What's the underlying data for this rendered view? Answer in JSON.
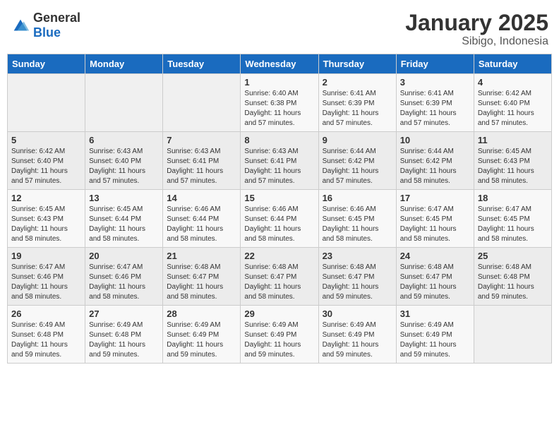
{
  "header": {
    "logo_general": "General",
    "logo_blue": "Blue",
    "month_title": "January 2025",
    "location": "Sibigo, Indonesia"
  },
  "weekdays": [
    "Sunday",
    "Monday",
    "Tuesday",
    "Wednesday",
    "Thursday",
    "Friday",
    "Saturday"
  ],
  "weeks": [
    [
      {
        "day": "",
        "sunrise": "",
        "sunset": "",
        "daylight": ""
      },
      {
        "day": "",
        "sunrise": "",
        "sunset": "",
        "daylight": ""
      },
      {
        "day": "",
        "sunrise": "",
        "sunset": "",
        "daylight": ""
      },
      {
        "day": "1",
        "sunrise": "Sunrise: 6:40 AM",
        "sunset": "Sunset: 6:38 PM",
        "daylight": "Daylight: 11 hours and 57 minutes."
      },
      {
        "day": "2",
        "sunrise": "Sunrise: 6:41 AM",
        "sunset": "Sunset: 6:39 PM",
        "daylight": "Daylight: 11 hours and 57 minutes."
      },
      {
        "day": "3",
        "sunrise": "Sunrise: 6:41 AM",
        "sunset": "Sunset: 6:39 PM",
        "daylight": "Daylight: 11 hours and 57 minutes."
      },
      {
        "day": "4",
        "sunrise": "Sunrise: 6:42 AM",
        "sunset": "Sunset: 6:40 PM",
        "daylight": "Daylight: 11 hours and 57 minutes."
      }
    ],
    [
      {
        "day": "5",
        "sunrise": "Sunrise: 6:42 AM",
        "sunset": "Sunset: 6:40 PM",
        "daylight": "Daylight: 11 hours and 57 minutes."
      },
      {
        "day": "6",
        "sunrise": "Sunrise: 6:43 AM",
        "sunset": "Sunset: 6:40 PM",
        "daylight": "Daylight: 11 hours and 57 minutes."
      },
      {
        "day": "7",
        "sunrise": "Sunrise: 6:43 AM",
        "sunset": "Sunset: 6:41 PM",
        "daylight": "Daylight: 11 hours and 57 minutes."
      },
      {
        "day": "8",
        "sunrise": "Sunrise: 6:43 AM",
        "sunset": "Sunset: 6:41 PM",
        "daylight": "Daylight: 11 hours and 57 minutes."
      },
      {
        "day": "9",
        "sunrise": "Sunrise: 6:44 AM",
        "sunset": "Sunset: 6:42 PM",
        "daylight": "Daylight: 11 hours and 57 minutes."
      },
      {
        "day": "10",
        "sunrise": "Sunrise: 6:44 AM",
        "sunset": "Sunset: 6:42 PM",
        "daylight": "Daylight: 11 hours and 58 minutes."
      },
      {
        "day": "11",
        "sunrise": "Sunrise: 6:45 AM",
        "sunset": "Sunset: 6:43 PM",
        "daylight": "Daylight: 11 hours and 58 minutes."
      }
    ],
    [
      {
        "day": "12",
        "sunrise": "Sunrise: 6:45 AM",
        "sunset": "Sunset: 6:43 PM",
        "daylight": "Daylight: 11 hours and 58 minutes."
      },
      {
        "day": "13",
        "sunrise": "Sunrise: 6:45 AM",
        "sunset": "Sunset: 6:44 PM",
        "daylight": "Daylight: 11 hours and 58 minutes."
      },
      {
        "day": "14",
        "sunrise": "Sunrise: 6:46 AM",
        "sunset": "Sunset: 6:44 PM",
        "daylight": "Daylight: 11 hours and 58 minutes."
      },
      {
        "day": "15",
        "sunrise": "Sunrise: 6:46 AM",
        "sunset": "Sunset: 6:44 PM",
        "daylight": "Daylight: 11 hours and 58 minutes."
      },
      {
        "day": "16",
        "sunrise": "Sunrise: 6:46 AM",
        "sunset": "Sunset: 6:45 PM",
        "daylight": "Daylight: 11 hours and 58 minutes."
      },
      {
        "day": "17",
        "sunrise": "Sunrise: 6:47 AM",
        "sunset": "Sunset: 6:45 PM",
        "daylight": "Daylight: 11 hours and 58 minutes."
      },
      {
        "day": "18",
        "sunrise": "Sunrise: 6:47 AM",
        "sunset": "Sunset: 6:45 PM",
        "daylight": "Daylight: 11 hours and 58 minutes."
      }
    ],
    [
      {
        "day": "19",
        "sunrise": "Sunrise: 6:47 AM",
        "sunset": "Sunset: 6:46 PM",
        "daylight": "Daylight: 11 hours and 58 minutes."
      },
      {
        "day": "20",
        "sunrise": "Sunrise: 6:47 AM",
        "sunset": "Sunset: 6:46 PM",
        "daylight": "Daylight: 11 hours and 58 minutes."
      },
      {
        "day": "21",
        "sunrise": "Sunrise: 6:48 AM",
        "sunset": "Sunset: 6:47 PM",
        "daylight": "Daylight: 11 hours and 58 minutes."
      },
      {
        "day": "22",
        "sunrise": "Sunrise: 6:48 AM",
        "sunset": "Sunset: 6:47 PM",
        "daylight": "Daylight: 11 hours and 58 minutes."
      },
      {
        "day": "23",
        "sunrise": "Sunrise: 6:48 AM",
        "sunset": "Sunset: 6:47 PM",
        "daylight": "Daylight: 11 hours and 59 minutes."
      },
      {
        "day": "24",
        "sunrise": "Sunrise: 6:48 AM",
        "sunset": "Sunset: 6:47 PM",
        "daylight": "Daylight: 11 hours and 59 minutes."
      },
      {
        "day": "25",
        "sunrise": "Sunrise: 6:48 AM",
        "sunset": "Sunset: 6:48 PM",
        "daylight": "Daylight: 11 hours and 59 minutes."
      }
    ],
    [
      {
        "day": "26",
        "sunrise": "Sunrise: 6:49 AM",
        "sunset": "Sunset: 6:48 PM",
        "daylight": "Daylight: 11 hours and 59 minutes."
      },
      {
        "day": "27",
        "sunrise": "Sunrise: 6:49 AM",
        "sunset": "Sunset: 6:48 PM",
        "daylight": "Daylight: 11 hours and 59 minutes."
      },
      {
        "day": "28",
        "sunrise": "Sunrise: 6:49 AM",
        "sunset": "Sunset: 6:49 PM",
        "daylight": "Daylight: 11 hours and 59 minutes."
      },
      {
        "day": "29",
        "sunrise": "Sunrise: 6:49 AM",
        "sunset": "Sunset: 6:49 PM",
        "daylight": "Daylight: 11 hours and 59 minutes."
      },
      {
        "day": "30",
        "sunrise": "Sunrise: 6:49 AM",
        "sunset": "Sunset: 6:49 PM",
        "daylight": "Daylight: 11 hours and 59 minutes."
      },
      {
        "day": "31",
        "sunrise": "Sunrise: 6:49 AM",
        "sunset": "Sunset: 6:49 PM",
        "daylight": "Daylight: 11 hours and 59 minutes."
      },
      {
        "day": "",
        "sunrise": "",
        "sunset": "",
        "daylight": ""
      }
    ]
  ]
}
